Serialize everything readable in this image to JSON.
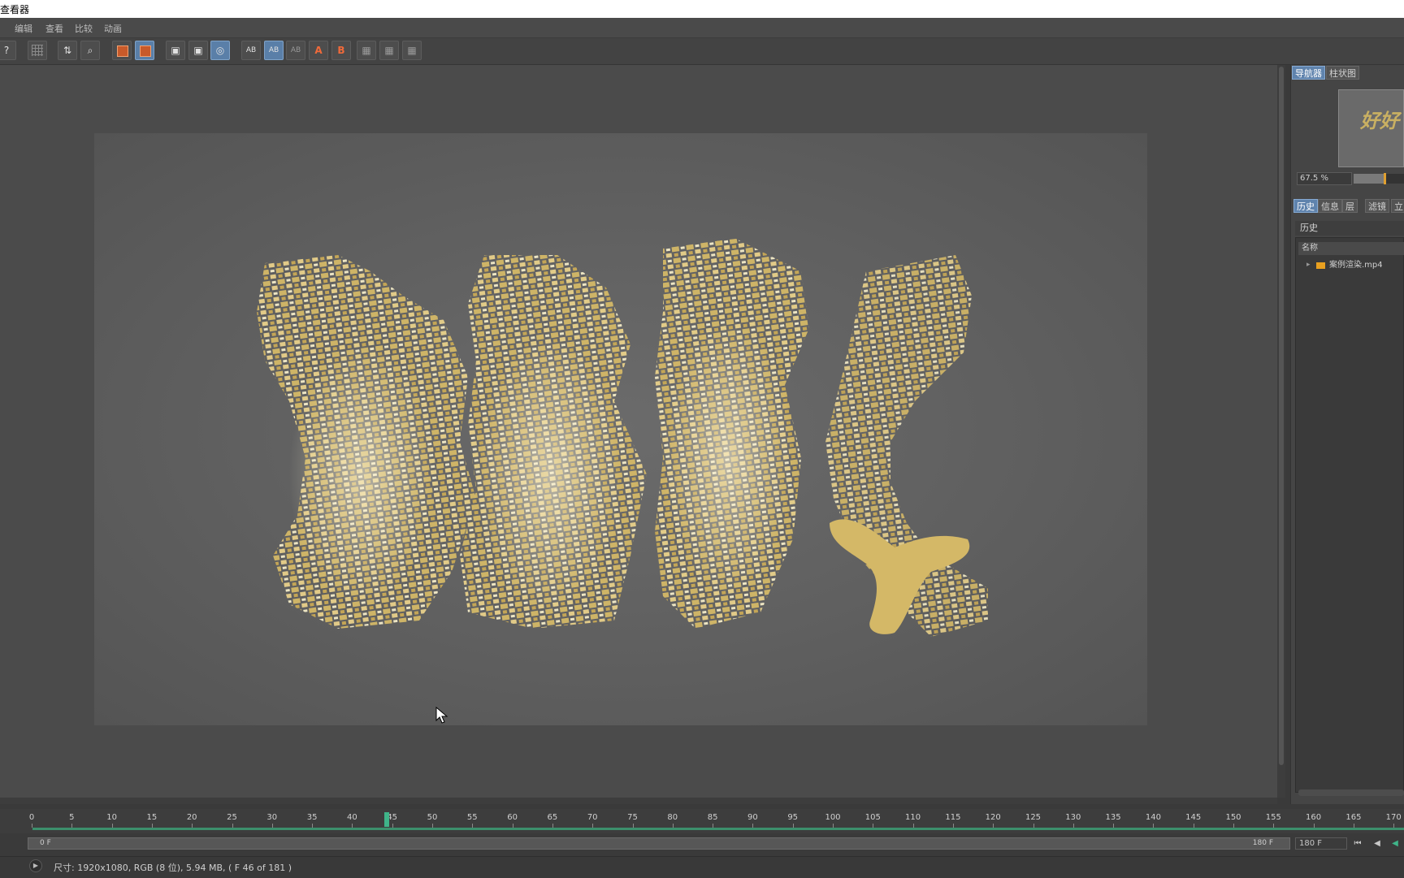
{
  "window": {
    "title": "查看器"
  },
  "menu": [
    "编辑",
    "查看",
    "比较",
    "动画"
  ],
  "toolbar": {
    "buttons": [
      {
        "name": "save-as-icon",
        "glyph": "?"
      },
      {
        "name": "grid-icon",
        "glyph": ""
      },
      {
        "name": "channel-icon",
        "glyph": "⇅"
      },
      {
        "name": "magnify-icon",
        "glyph": "⌕"
      },
      {
        "name": "render-region-icon",
        "glyph": ""
      },
      {
        "name": "render-active-icon",
        "glyph": ""
      },
      {
        "name": "display-icon",
        "glyph": "▣"
      },
      {
        "name": "display-alt-icon",
        "glyph": "▣"
      },
      {
        "name": "multi-pass-icon",
        "glyph": "◎"
      },
      {
        "name": "ab-compare-icon",
        "glyph": "AB"
      },
      {
        "name": "ab-split-icon",
        "glyph": "AB"
      },
      {
        "name": "ab-swap-icon",
        "glyph": "AB"
      },
      {
        "name": "set-a-icon",
        "glyph": "A"
      },
      {
        "name": "set-b-icon",
        "glyph": "B"
      },
      {
        "name": "layout-1-icon",
        "glyph": "▦"
      },
      {
        "name": "layout-2-icon",
        "glyph": "▦"
      },
      {
        "name": "layout-3-icon",
        "glyph": "▦"
      }
    ]
  },
  "navigator": {
    "tabs": [
      "导航器",
      "柱状图"
    ],
    "thumb_text": "好好",
    "zoom": "67.5 %",
    "zoom_level": 0.62
  },
  "history_panel": {
    "tabs": [
      "历史",
      "信息",
      "层",
      "滤镜",
      "立"
    ],
    "header": "历史",
    "column": "名称",
    "items": [
      "案例渲染.mp4"
    ]
  },
  "timeline": {
    "ticks": [
      0,
      5,
      10,
      15,
      20,
      25,
      30,
      35,
      40,
      45,
      50,
      55,
      60,
      65,
      70,
      75,
      80,
      85,
      90,
      95,
      100,
      105,
      110,
      115,
      120,
      125,
      130,
      135,
      140,
      145,
      150,
      155,
      160,
      165,
      170
    ],
    "current_frame": 45,
    "range_start": "0 F",
    "range_end": "180 F",
    "end_frame": "180 F"
  },
  "status": {
    "text": "尺寸: 1920x1080, RGB (8 位), 5.94 MB,  ( F 46 of 181 )"
  },
  "colors": {
    "gold": "#d4b867",
    "accent_blue": "#5f83ad",
    "timeline_green": "#3c8f6c"
  }
}
